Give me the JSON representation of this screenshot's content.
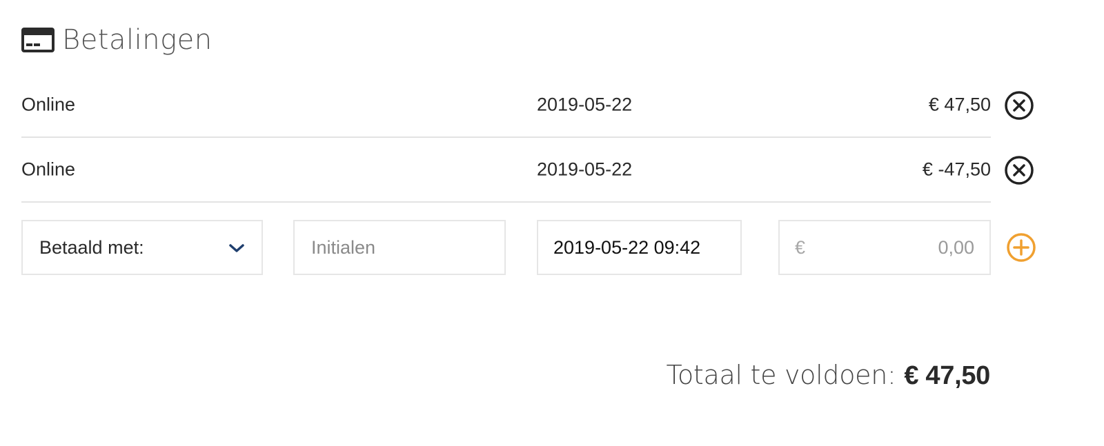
{
  "section": {
    "title": "Betalingen",
    "icon": "credit-card-icon"
  },
  "payments": [
    {
      "method": "Online",
      "date": "2019-05-22",
      "amount": "€ 47,50"
    },
    {
      "method": "Online",
      "date": "2019-05-22",
      "amount": "€ -47,50"
    }
  ],
  "new_payment": {
    "method_select_label": "Betaald met:",
    "initials_placeholder": "Initialen",
    "datetime_value": "2019-05-22 09:42",
    "currency_symbol": "€",
    "amount_placeholder": "0,00"
  },
  "total": {
    "label": "Totaal te voldoen:",
    "value": "€ 47,50"
  },
  "colors": {
    "accent_add": "#f0a030",
    "chevron": "#1f3f6e",
    "remove_icon": "#222222"
  }
}
